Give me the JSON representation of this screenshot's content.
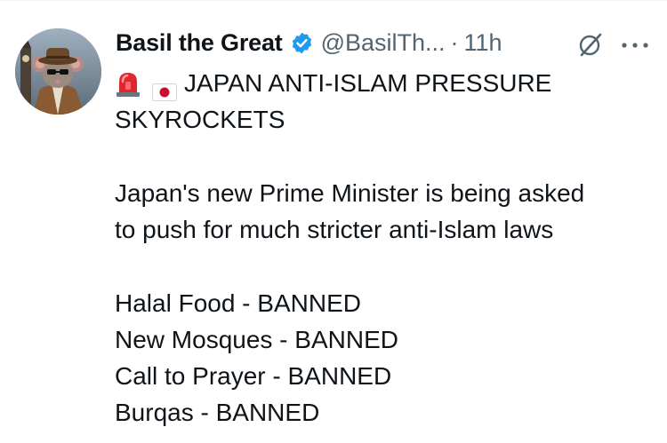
{
  "tweet": {
    "author": {
      "display_name": "Basil the Great",
      "handle": "@BasilTh...",
      "separator": "·",
      "time": "11h",
      "verified": true
    },
    "icons": {
      "avatar": "avatar-image",
      "verified": "verified-badge-icon",
      "grok": "grok-icon",
      "more": "more-options-icon",
      "siren": "siren-emoji-icon",
      "flag": "japan-flag-icon"
    },
    "text": {
      "headline_line1": "JAPAN ANTI-ISLAM PRESSURE",
      "headline_line2": "SKYROCKETS",
      "body_line1": "Japan's new Prime Minister is being asked",
      "body_line2": "to push for much stricter anti-Islam laws",
      "items": [
        "Halal Food - BANNED",
        "New Mosques - BANNED",
        "Call to Prayer - BANNED",
        "Burqas - BANNED"
      ]
    },
    "colors": {
      "text": "#0f1419",
      "secondary": "#536471",
      "verified_blue": "#1d9bf0"
    }
  }
}
